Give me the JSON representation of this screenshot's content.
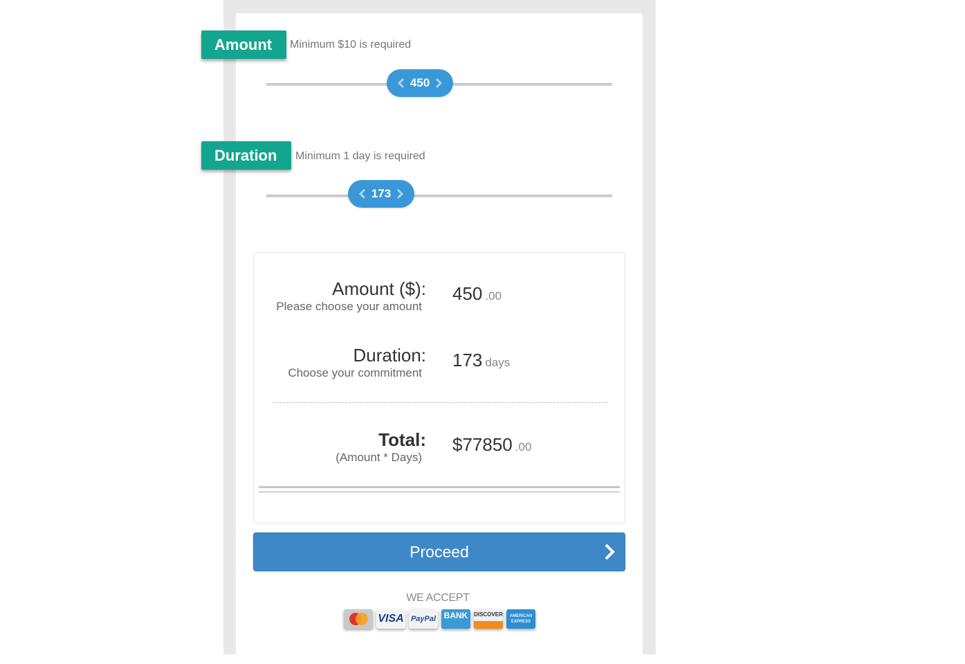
{
  "amount_section": {
    "label": "Amount",
    "hint": "Minimum $10 is required",
    "slider_value": "450",
    "slider_fraction": 0.44
  },
  "duration_section": {
    "label": "Duration",
    "hint": "Minimum 1 day is required",
    "slider_value": "173",
    "slider_fraction": 0.33
  },
  "summary": {
    "amount": {
      "label": "Amount ($):",
      "sublabel": "Please choose your amount",
      "value": "450",
      "unit": ".00"
    },
    "duration": {
      "label": "Duration:",
      "sublabel": "Choose your commitment",
      "value": "173",
      "unit": "days"
    },
    "total": {
      "label": "Total:",
      "sublabel": "(Amount * Days)",
      "value": "$77850",
      "unit": ".00"
    }
  },
  "proceed_label": "Proceed",
  "accept_label": "WE ACCEPT",
  "payment_methods": [
    "MasterCard",
    "VISA",
    "PayPal",
    "BANK",
    "DISCOVER",
    "AMERICAN EXPRESS"
  ],
  "colors": {
    "ribbon": "#13a68e",
    "slider_handle": "#3a98d8",
    "proceed_button": "#3e88c8"
  }
}
